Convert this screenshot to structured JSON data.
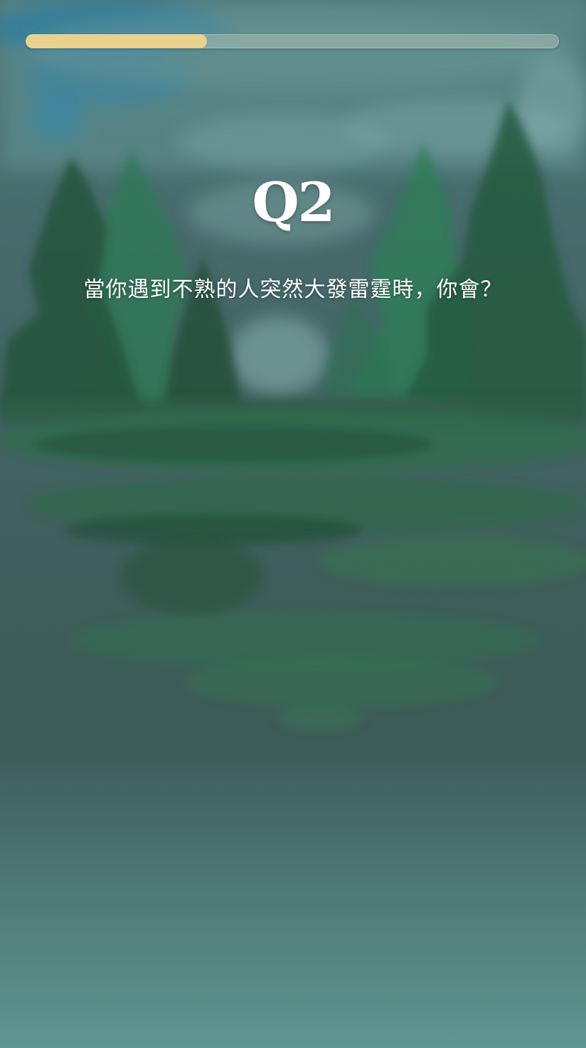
{
  "quiz": {
    "progress_percent": 34,
    "question_number": "Q2",
    "question_text": "當你遇到不熟的人突然大發雷霆時，你會？"
  },
  "colors": {
    "progress_fill": "#e9d28e",
    "progress_track": "#9fb4aa",
    "text": "#ffffff"
  },
  "background": {
    "illustration": "watercolor-pine-forest"
  }
}
